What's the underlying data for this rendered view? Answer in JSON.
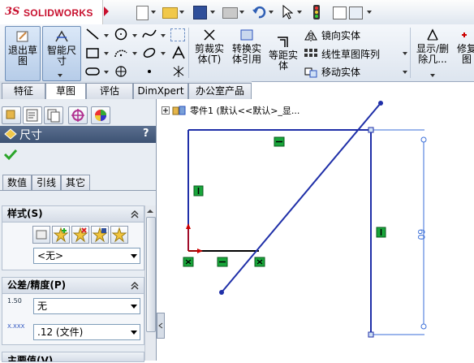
{
  "brand": {
    "logo_prefix": "3S",
    "logo_text": "SOLIDWORKS"
  },
  "ribbon": {
    "exit_sketch_label": "退出草\n图",
    "smart_dim_label": "智能尺\n寸",
    "trim_label": "剪裁实\n体(T)",
    "convert_label": "转换实\n体引用",
    "offset_label": "等距实\n体",
    "mirror_label": "镜向实体",
    "linear_pattern_label": "线性草图阵列",
    "move_label": "移动实体",
    "show_delete_label": "显示/删\n除几...",
    "repair_label": "修复\n图"
  },
  "tabs": [
    {
      "label": "特征"
    },
    {
      "label": "草图"
    },
    {
      "label": "评估"
    },
    {
      "label": "DimXpert"
    },
    {
      "label": "办公室产品"
    }
  ],
  "tree": {
    "root_label": "零件1 (默认<<默认>_显..."
  },
  "panel": {
    "title": "尺寸",
    "help": "?",
    "subtabs": [
      "数值",
      "引线",
      "其它"
    ],
    "style_section": {
      "header": "样式(S)",
      "select_value": "<无>"
    },
    "tolerance_section": {
      "header": "公差/精度(P)",
      "tol_value": "无",
      "precision_value": ".12 (文件)",
      "tol_icon_text": "1.50",
      "prec_icon_text": "X.XXX"
    },
    "next_section_header": "主要值(V)"
  },
  "canvas": {
    "dimension_value": "60",
    "relation_symbol_h": "—",
    "relation_symbol_v": "|"
  },
  "colors": {
    "accent": "#1f3aa8",
    "dimension": "#3a6ed8",
    "relation_green": "#18a63a",
    "check_green": "#2aa52a",
    "header_bg": "#3d5273"
  }
}
